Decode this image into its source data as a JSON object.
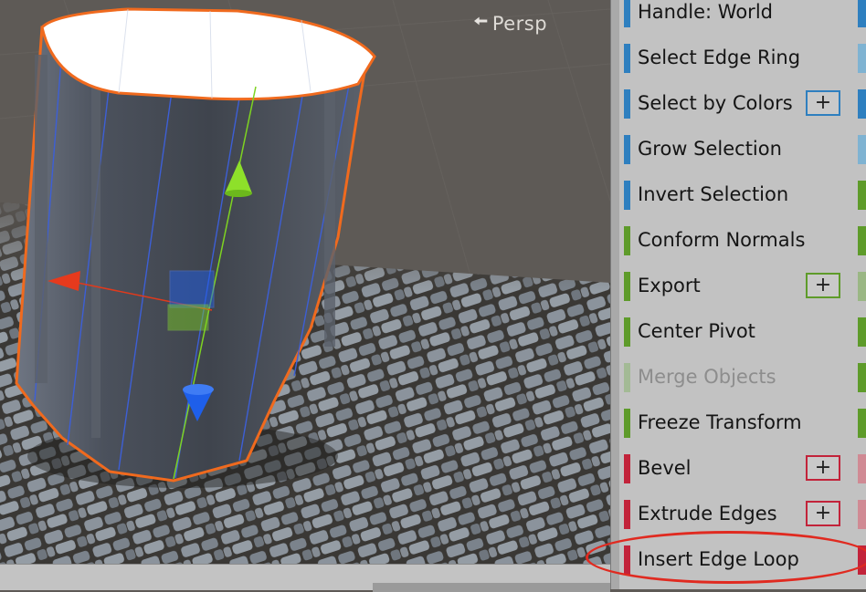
{
  "viewport": {
    "camera_label": "Persp",
    "camera_icon": "chevron-left-icon",
    "colors": {
      "background": "#5e5a56",
      "cylinder": "#4a4f58",
      "selection_outline": "#f06a1e",
      "gizmo_x": "#e03a1c",
      "gizmo_y": "#7ed321",
      "gizmo_z": "#1f5de8"
    }
  },
  "panel": {
    "rows": [
      {
        "label": "Handle: World",
        "color": "#2e7fbf",
        "has_plus": false,
        "disabled": false,
        "edge_color": "#2e7fbf"
      },
      {
        "label": "Select Edge Ring",
        "color": "#2e7fbf",
        "has_plus": false,
        "disabled": false,
        "edge_color": "#7fb3d2"
      },
      {
        "label": "Select by Colors",
        "color": "#2e7fbf",
        "has_plus": true,
        "plus_label": "+",
        "disabled": false,
        "edge_color": "#2e7fbf"
      },
      {
        "label": "Grow Selection",
        "color": "#2e7fbf",
        "has_plus": false,
        "disabled": false,
        "edge_color": "#7fb3d2"
      },
      {
        "label": "Invert Selection",
        "color": "#2e7fbf",
        "has_plus": false,
        "disabled": false,
        "edge_color": "#5e9b2a"
      },
      {
        "label": "Conform Normals",
        "color": "#5e9b2a",
        "has_plus": false,
        "disabled": false,
        "edge_color": "#5e9b2a"
      },
      {
        "label": "Export",
        "color": "#5e9b2a",
        "has_plus": true,
        "plus_label": "+",
        "disabled": false,
        "edge_color": "#9ab784"
      },
      {
        "label": "Center Pivot",
        "color": "#5e9b2a",
        "has_plus": false,
        "disabled": false,
        "edge_color": "#5e9b2a"
      },
      {
        "label": "Merge Objects",
        "color": "#a3ba95",
        "has_plus": false,
        "disabled": true,
        "edge_color": "#5e9b2a"
      },
      {
        "label": "Freeze Transform",
        "color": "#5e9b2a",
        "has_plus": false,
        "disabled": false,
        "edge_color": "#5e9b2a"
      },
      {
        "label": "Bevel",
        "color": "#c2233a",
        "has_plus": true,
        "plus_label": "+",
        "disabled": false,
        "edge_color": "#d08a94"
      },
      {
        "label": "Extrude Edges",
        "color": "#c2233a",
        "has_plus": true,
        "plus_label": "+",
        "disabled": false,
        "edge_color": "#d08a94"
      },
      {
        "label": "Insert Edge Loop",
        "color": "#c2233a",
        "has_plus": false,
        "disabled": false,
        "edge_color": "#c2233a"
      }
    ]
  }
}
